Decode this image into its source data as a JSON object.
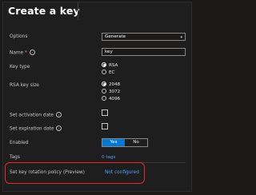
{
  "header": {
    "title": "Create a key"
  },
  "form": {
    "options": {
      "label": "Options",
      "value": "Generate"
    },
    "name": {
      "label": "Name",
      "required_mark": "*",
      "info": "i",
      "value": "key"
    },
    "key_type": {
      "label": "Key type",
      "options": [
        "RSA",
        "EC"
      ],
      "selected": "RSA"
    },
    "rsa_key_size": {
      "label": "RSA key size",
      "options": [
        "2048",
        "3072",
        "4096"
      ],
      "selected": "2048"
    },
    "activation": {
      "label": "Set activation date",
      "info": "i"
    },
    "expiration": {
      "label": "Set expiration date",
      "info": "i"
    },
    "enabled": {
      "label": "Enabled",
      "yes": "Yes",
      "no": "No",
      "selected": "Yes"
    },
    "tags": {
      "label": "Tags",
      "value": "0 tags"
    },
    "rotation": {
      "label": "Set key rotation policy (Preview)",
      "value": "Not configured"
    }
  },
  "icons": {
    "dropdown": "chevron-down-icon",
    "info": "info-icon"
  },
  "colors": {
    "accent": "#0078d4",
    "link": "#4da3ff",
    "highlight": "#e8262c",
    "background": "#1b1a19"
  }
}
